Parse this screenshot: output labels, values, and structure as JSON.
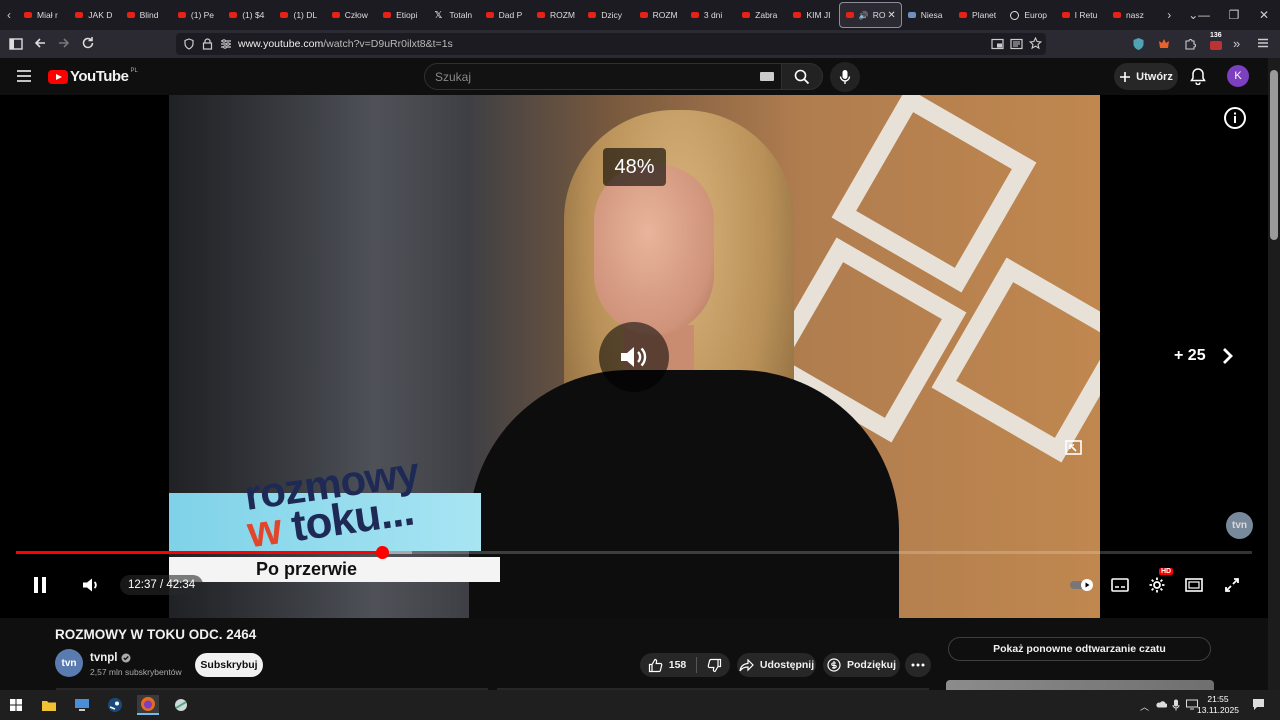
{
  "browser": {
    "tabs": [
      {
        "label": "Miał r"
      },
      {
        "label": "JAK D"
      },
      {
        "label": "Blind"
      },
      {
        "label": "(1) Pe"
      },
      {
        "label": "(1) $4"
      },
      {
        "label": "(1) DL"
      },
      {
        "label": "Człow"
      },
      {
        "label": "Etiopi"
      },
      {
        "label": "Totaln"
      },
      {
        "label": "Dad P"
      },
      {
        "label": "ROZM"
      },
      {
        "label": "Dzicy"
      },
      {
        "label": "ROZM"
      },
      {
        "label": "3 dni"
      },
      {
        "label": "Zabra"
      },
      {
        "label": "KIM JI"
      },
      {
        "label": "RO"
      },
      {
        "label": "Niesa"
      },
      {
        "label": "Planet"
      },
      {
        "label": "Europ"
      },
      {
        "label": "I Retu"
      },
      {
        "label": "nasz"
      }
    ],
    "url_host": "www.youtube.com",
    "url_path": "/watch?v=D9uRr0ilxt8&t=1s",
    "extension_badge": "136"
  },
  "youtube": {
    "logo_text": "YouTube",
    "country_code": "PL",
    "search_placeholder": "Szukaj",
    "create_label": "Utwórz",
    "avatar_letter": "K"
  },
  "player": {
    "volume_overlay": "48%",
    "endscreen_more": "+ 25",
    "watermark": "tvn",
    "show_logo_line1": "rozmowy",
    "show_logo_w": "w",
    "show_logo_rest": "toku...",
    "lower_third": "Po przerwie",
    "current_time": "12:37",
    "duration": "42:34",
    "time_display": "12:37 / 42:34",
    "progress_played": 0.296,
    "progress_buffered": 0.32,
    "hd_badge": "HD"
  },
  "video": {
    "title": "ROZMOWY W TOKU ODC. 2464",
    "channel_name": "tvnpl",
    "channel_avatar_text": "tvn",
    "subscribers": "2,57 mln subskrybentów",
    "subscribe_label": "Subskrybuj",
    "likes": "158",
    "share_label": "Udostępnij",
    "thanks_label": "Podziękuj",
    "chat_replay_label": "Pokaż ponowne odtwarzanie czatu"
  },
  "taskbar": {
    "time": "21:55",
    "date": "13.11.2025"
  },
  "colors": {
    "yt_red": "#ff0000",
    "progress_red": "#ff0000",
    "bg": "#0f0f0f"
  }
}
